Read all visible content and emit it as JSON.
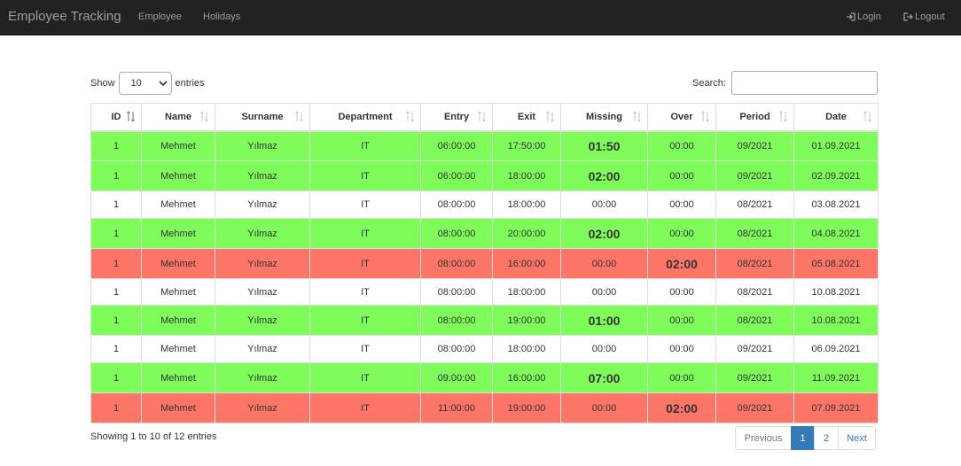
{
  "navbar": {
    "brand": "Employee Tracking",
    "links": [
      "Employee",
      "Holidays"
    ],
    "login": "Login",
    "logout": "Logout"
  },
  "controls": {
    "show_label": "Show",
    "page_size": "10",
    "entries_label": "entries",
    "search_label": "Search:",
    "search_value": ""
  },
  "table": {
    "columns": [
      "ID",
      "Name",
      "Surname",
      "Department",
      "Entry",
      "Exit",
      "Missing",
      "Over",
      "Period",
      "Date"
    ],
    "rows": [
      {
        "status": "green",
        "cells": [
          "1",
          "Mehmet",
          "Yılmaz",
          "IT",
          "06:00:00",
          "17:50:00",
          "01:50",
          "00:00",
          "09/2021",
          "01.09.2021"
        ]
      },
      {
        "status": "green",
        "cells": [
          "1",
          "Mehmet",
          "Yılmaz",
          "IT",
          "06:00:00",
          "18:00:00",
          "02:00",
          "00:00",
          "09/2021",
          "02.09.2021"
        ]
      },
      {
        "status": "white",
        "cells": [
          "1",
          "Mehmet",
          "Yılmaz",
          "IT",
          "08:00:00",
          "18:00:00",
          "00:00",
          "00:00",
          "08/2021",
          "03.08.2021"
        ]
      },
      {
        "status": "green",
        "cells": [
          "1",
          "Mehmet",
          "Yılmaz",
          "IT",
          "08:00:00",
          "20:00:00",
          "02:00",
          "00:00",
          "08/2021",
          "04.08.2021"
        ]
      },
      {
        "status": "red",
        "cells": [
          "1",
          "Mehmet",
          "Yılmaz",
          "IT",
          "08:00:00",
          "16:00:00",
          "00:00",
          "02:00",
          "08/2021",
          "05.08.2021"
        ]
      },
      {
        "status": "white",
        "cells": [
          "1",
          "Mehmet",
          "Yılmaz",
          "IT",
          "08:00:00",
          "18:00:00",
          "00:00",
          "00:00",
          "08/2021",
          "10.08.2021"
        ]
      },
      {
        "status": "green",
        "cells": [
          "1",
          "Mehmet",
          "Yılmaz",
          "IT",
          "08:00:00",
          "19:00:00",
          "01:00",
          "00:00",
          "08/2021",
          "10.08.2021"
        ]
      },
      {
        "status": "white",
        "cells": [
          "1",
          "Mehmet",
          "Yılmaz",
          "IT",
          "08:00:00",
          "18:00:00",
          "00:00",
          "00:00",
          "09/2021",
          "06.09.2021"
        ]
      },
      {
        "status": "green",
        "cells": [
          "1",
          "Mehmet",
          "Yılmaz",
          "IT",
          "09:00:00",
          "16:00:00",
          "07:00",
          "00:00",
          "09/2021",
          "11.09.2021"
        ]
      },
      {
        "status": "red",
        "cells": [
          "1",
          "Mehmet",
          "Yılmaz",
          "IT",
          "11:00:00",
          "19:00:00",
          "00:00",
          "02:00",
          "09/2021",
          "07.09.2021"
        ]
      }
    ]
  },
  "footer": {
    "info": "Showing 1 to 10 of 12 entries",
    "previous": "Previous",
    "pages": [
      "1",
      "2"
    ],
    "next": "Next"
  },
  "colors": {
    "navbar": "#222222",
    "row_green": "#7dfc5a",
    "row_red": "#fd7567",
    "active_page": "#337ab7"
  }
}
